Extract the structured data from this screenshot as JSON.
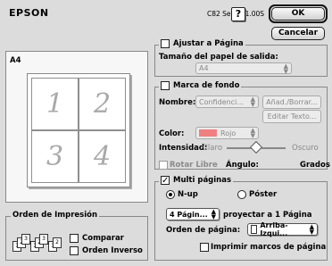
{
  "header": {
    "brand": "EPSON",
    "model": "C82 Series 1.00S",
    "help_label": "?",
    "ok_label": "OK",
    "cancel_label": "Cancelar"
  },
  "preview": {
    "paper_label": "A4",
    "pages": [
      "1",
      "2",
      "3",
      "4"
    ]
  },
  "print_order": {
    "title": "Orden de Impresión",
    "icon_labels": [
      "1",
      "2",
      "3"
    ],
    "collate_label": "Comparar",
    "reverse_label": "Orden Inverso",
    "collate_checked": false,
    "reverse_checked": false
  },
  "fit_page": {
    "title": "Ajustar a Página",
    "checked": false,
    "output_label": "Tamaño del papel de salida:",
    "output_value": "A4"
  },
  "watermark": {
    "title": "Marca de fondo",
    "checked": false,
    "name_label": "Nombre:",
    "name_value": "Confidenci...",
    "add_delete_label": "Añad./Borrar...",
    "edit_text_label": "Editar Texto...",
    "color_label": "Color:",
    "color_value": "Rojo",
    "color_swatch": "#f08080",
    "intensity_label": "Intensidad:",
    "intensity_low": "Claro",
    "intensity_high": "Oscuro",
    "intensity_level": 0.5,
    "rotate_label": "Rotar Libre",
    "angle_label": "Ángulo:",
    "degrees_label": "Grados"
  },
  "multipage": {
    "title": "Multi páginas",
    "checked": true,
    "nup_label": "N-up",
    "poster_label": "Póster",
    "mode_selected": "N-up",
    "pages_value": "4 Págin...",
    "project_label": "proyectar a 1 Página",
    "order_label": "Orden de página:",
    "order_value": "Arriba-Izqui...",
    "print_frames_label": "Imprimir marcos de página",
    "print_frames_checked": false
  }
}
